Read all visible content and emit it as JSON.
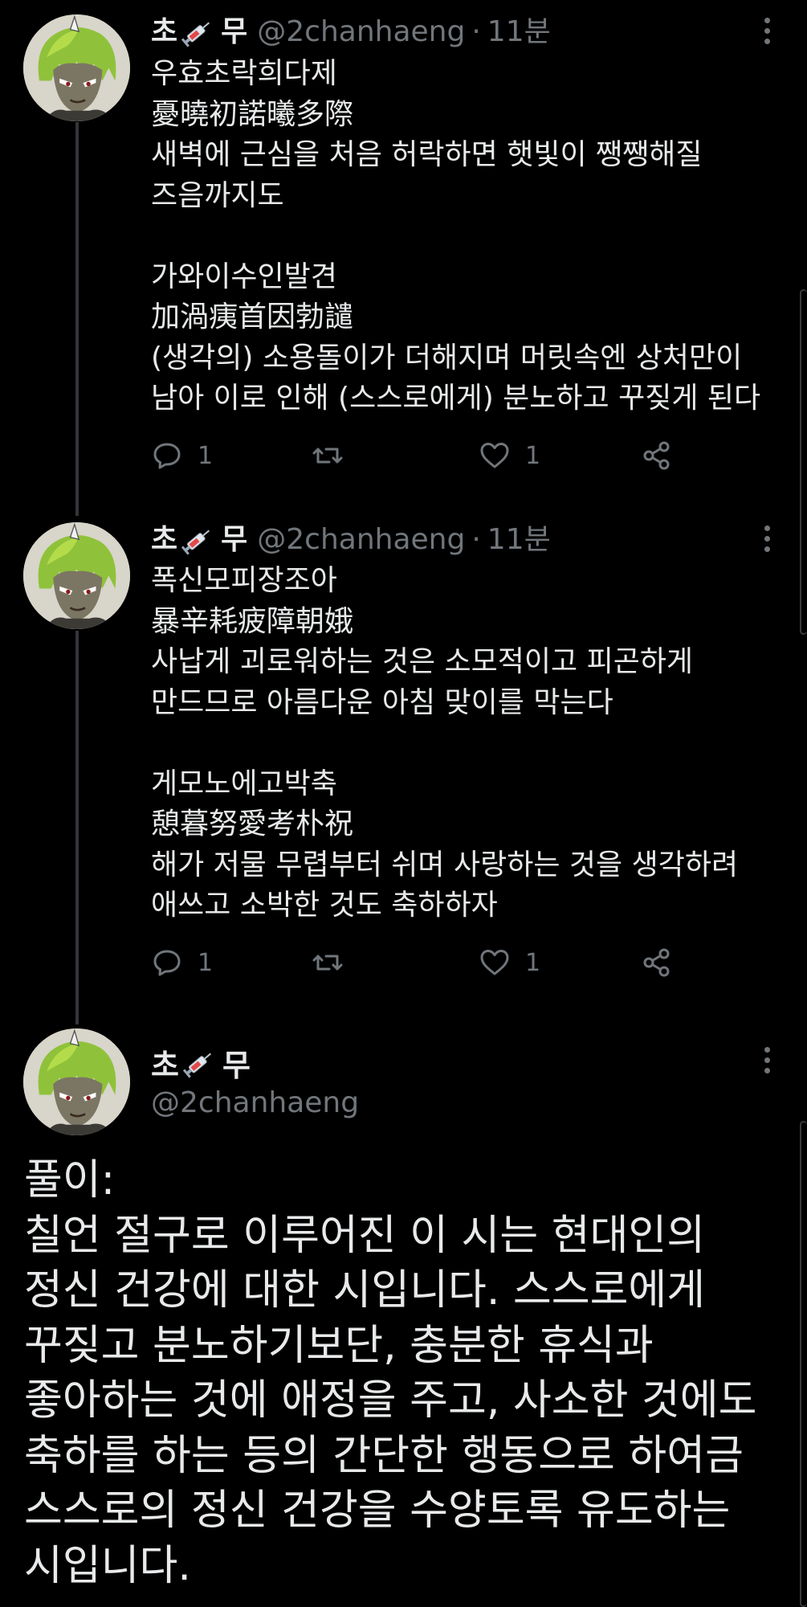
{
  "tweets": [
    {
      "display_name_pre": "초",
      "display_name_post": "무",
      "handle": "@2chanhaeng",
      "separator": "·",
      "time": "11분",
      "text": "우효초락희다제\n憂曉初諾曦多際\n새벽에 근심을 처음 허락하면 햇빛이 쨍쨍해질\n즈음까지도\n\n가와이수인발견\n加渦痍首因勃譴\n(생각의) 소용돌이가 더해지며 머릿속엔 상처만이\n남아 이로 인해 (스스로에게) 분노하고 꾸짖게 된다",
      "reply_count": "1",
      "like_count": "1"
    },
    {
      "display_name_pre": "초",
      "display_name_post": "무",
      "handle": "@2chanhaeng",
      "separator": "·",
      "time": "11분",
      "text": "폭신모피장조아\n暴辛耗疲障朝娥\n사납게 괴로워하는 것은 소모적이고 피곤하게\n만드므로 아름다운 아침 맞이를 막는다\n\n게모노에고박축\n憩暮努愛考朴祝\n해가 저물 무렵부터 쉬며 사랑하는 것을 생각하려\n애쓰고 소박한 것도 축하하자",
      "reply_count": "1",
      "like_count": "1"
    }
  ],
  "main_tweet": {
    "display_name_pre": "초",
    "display_name_post": "무",
    "handle": "@2chanhaeng",
    "text": "풀이:\n칠언 절구로 이루어진 이 시는 현대인의\n정신 건강에 대한 시입니다. 스스로에게\n꾸짖고 분노하기보단, 충분한 휴식과\n좋아하는 것에 애정을 주고, 사소한 것에도\n축하를 하는 등의 간단한 행동으로 하여금\n스스로의 정신 건강을 수양토록 유도하는\n시입니다."
  },
  "icons": {
    "reply": "reply-icon",
    "retweet": "retweet-icon",
    "like": "heart-icon",
    "share": "share-icon",
    "more": "more-icon",
    "emoji": "syringe-icon"
  },
  "colors": {
    "background": "#000000",
    "text": "#e7e9ea",
    "muted": "#71767b",
    "thread_line": "#333639"
  }
}
